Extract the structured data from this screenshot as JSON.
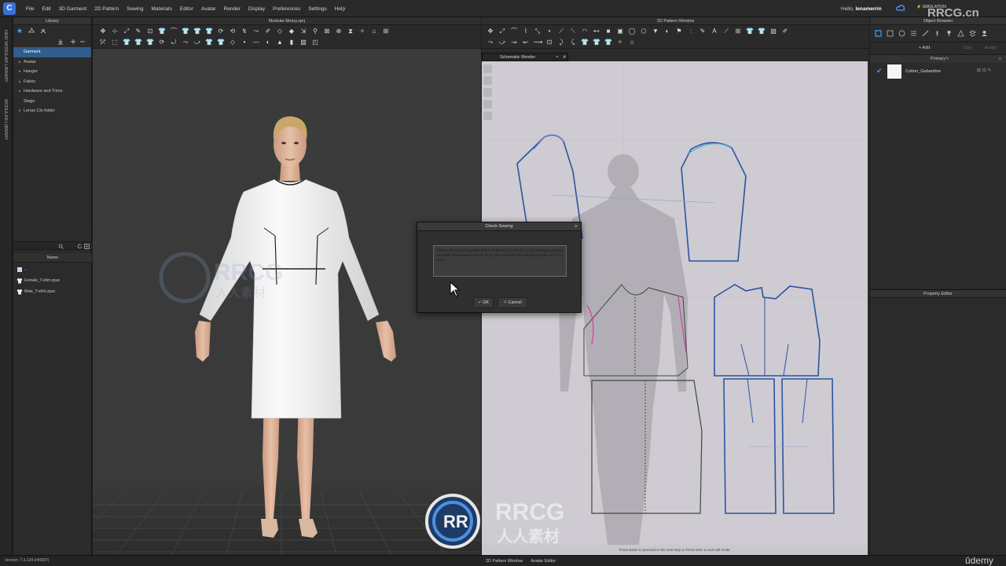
{
  "app": {
    "logo_letter": "C",
    "menu": [
      "File",
      "Edit",
      "3D Garment",
      "2D Pattern",
      "Sewing",
      "Materials",
      "Editor",
      "Avatar",
      "Render",
      "Display",
      "Preferences",
      "Settings",
      "Help"
    ],
    "greeting": "Hello, ",
    "username": "lenamerrin",
    "simulation_label": "SIMULATION",
    "watermark": "RRCG.cn",
    "accent": "#3b6fd8"
  },
  "left_strip": {
    "tab1": "NEW MODULAR LIBRARY",
    "tab2": "MODULAR LIBRARY"
  },
  "library": {
    "title": "Library",
    "tree": [
      {
        "label": "Garment",
        "selected": true,
        "expandable": false
      },
      {
        "label": "Avatar",
        "selected": false,
        "expandable": true
      },
      {
        "label": "Hanger",
        "selected": false,
        "expandable": true
      },
      {
        "label": "Fabric",
        "selected": false,
        "expandable": true
      },
      {
        "label": "Hardware and Trims",
        "selected": false,
        "expandable": true
      },
      {
        "label": "Stage",
        "selected": false,
        "expandable": false
      },
      {
        "label": "Lenas Clo folder",
        "selected": false,
        "expandable": true
      }
    ],
    "file_column_header": "Name",
    "files": [
      "..",
      "Female_T-shirt.zpac",
      "Male_T-shirt.zpac"
    ]
  },
  "viewport": {
    "title": "Modular library.zprj"
  },
  "pattern_window": {
    "title": "2D Pattern Window",
    "tab": "Schematic Render",
    "status": "Press Enter to proceed to the next step or Press ESC to exit edit mode"
  },
  "object_browser": {
    "title": "Object Browser",
    "add": "+ Add",
    "copy": "Copy",
    "assign": "Assign",
    "group": "Primary",
    "fabric": "Cotton_Gabardine"
  },
  "property_editor": {
    "title": "Property Editor"
  },
  "dialog": {
    "title": "Check Sewing",
    "message": "Please check your tag lines before finalizing your blocks. If any changes need to be made please select cancel. If you are satisfied with everything select ok or hit enter.",
    "ok": "OK",
    "cancel": "Cancel"
  },
  "bottom": {
    "version": "Version: 7.3.134 (r46087)",
    "tabs": [
      "2D Pattern Window",
      "Avatar Editor"
    ],
    "brand": "ūdemy"
  },
  "watermark_logo": {
    "main": "RRCG",
    "sub": "人人素材"
  }
}
